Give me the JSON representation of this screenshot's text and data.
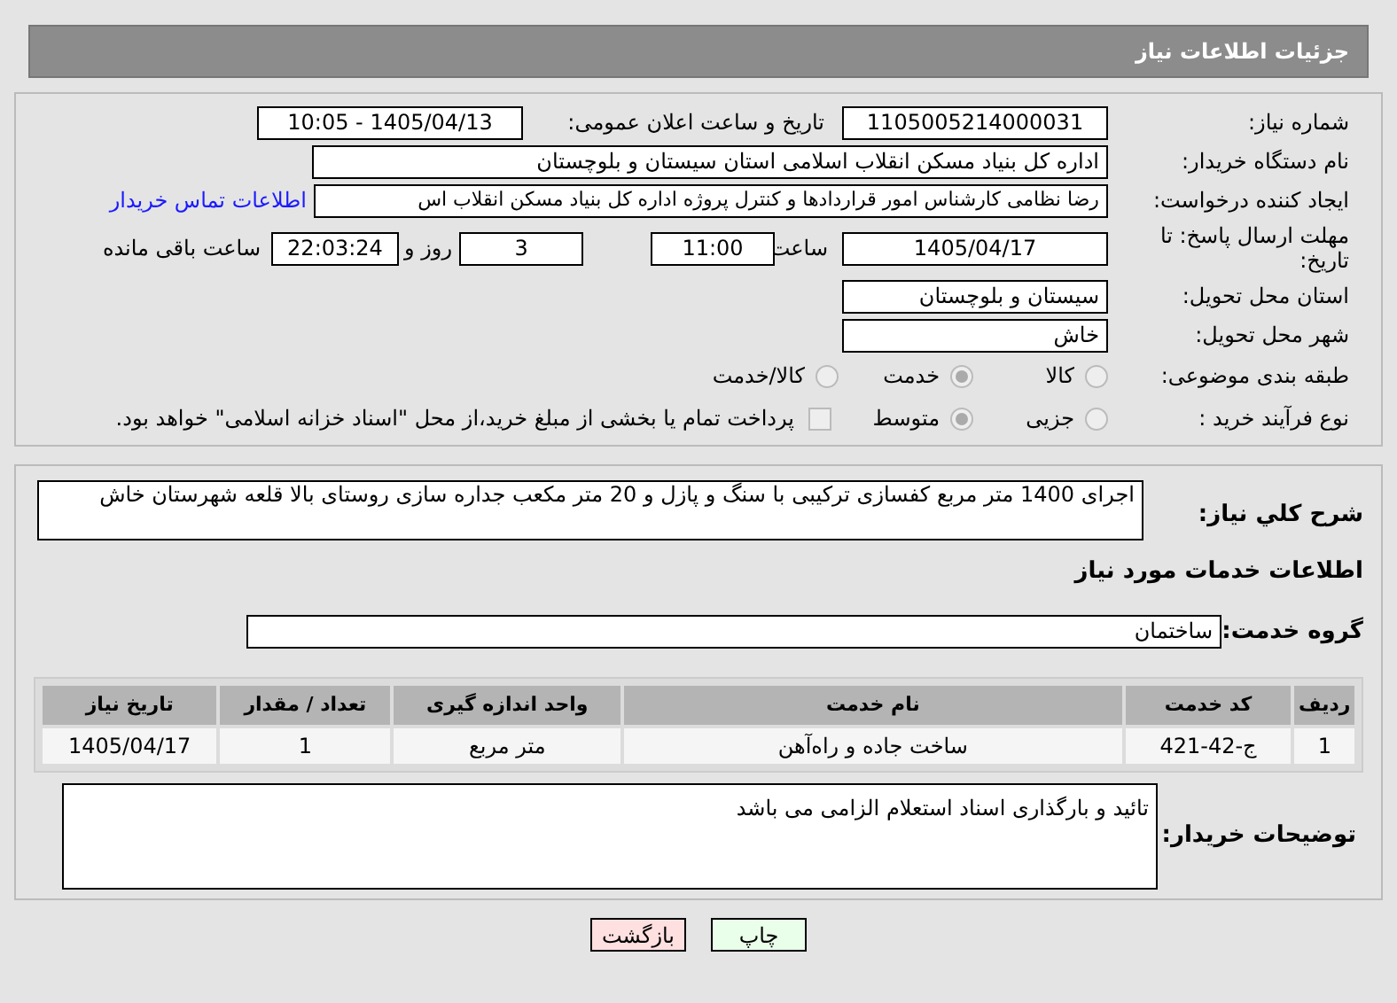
{
  "header": {
    "title": "جزئیات اطلاعات نیاز"
  },
  "need_number": {
    "label": "شماره نیاز:",
    "value": "1105005214000031"
  },
  "announce_datetime": {
    "label": "تاریخ و ساعت اعلان عمومی:",
    "value": "1405/04/13 - 10:05"
  },
  "buyer_org": {
    "label": "نام دستگاه خریدار:",
    "value": "اداره کل بنیاد مسکن انقلاب اسلامی استان سیستان و بلوچستان"
  },
  "requester": {
    "label": "ایجاد کننده درخواست:",
    "value": "رضا نظامی کارشناس امور قراردادها و کنترل پروژه اداره کل بنیاد مسکن انقلاب اس",
    "link": "اطلاعات تماس خریدار"
  },
  "deadline": {
    "label": "مهلت ارسال پاسخ: تا تاریخ:",
    "date": "1405/04/17",
    "time_label": "ساعت",
    "time": "11:00",
    "days": "3",
    "days_label": "روز و",
    "remaining": "22:03:24",
    "remaining_label": "ساعت باقی مانده"
  },
  "province": {
    "label": "استان محل تحویل:",
    "value": "سیستان و بلوچستان"
  },
  "city": {
    "label": "شهر محل تحویل:",
    "value": "خاش"
  },
  "category": {
    "label": "طبقه بندی موضوعی:",
    "options": [
      {
        "label": "کالا",
        "selected": false
      },
      {
        "label": "خدمت",
        "selected": true
      },
      {
        "label": "کالا/خدمت",
        "selected": false
      }
    ]
  },
  "purchase_type": {
    "label": "نوع فرآیند خرید :",
    "options": [
      {
        "label": "جزیی",
        "selected": false
      },
      {
        "label": "متوسط",
        "selected": true
      }
    ],
    "treasury": {
      "label": "پرداخت تمام یا بخشی از مبلغ خرید،از محل \"اسناد خزانه اسلامی\" خواهد بود.",
      "checked": false
    }
  },
  "description": {
    "label": "شرح کلي نياز:",
    "value": "اجرای 1400 متر مربع کفسازی ترکیبی با سنگ و پازل و 20 متر مکعب جداره سازی روستای بالا قلعه شهرستان خاش"
  },
  "services_title": "اطلاعات خدمات مورد نیاز",
  "service_group": {
    "label": "گروه خدمت:",
    "value": "ساختمان"
  },
  "table": {
    "columns": [
      "ردیف",
      "کد خدمت",
      "نام خدمت",
      "واحد اندازه گیری",
      "تعداد / مقدار",
      "تاریخ نیاز"
    ],
    "rows": [
      [
        "1",
        "ج-42-421",
        "ساخت جاده و راه‌آهن",
        "متر مربع",
        "1",
        "1405/04/17"
      ]
    ]
  },
  "buyer_notes": {
    "label": "توضیحات خریدار:",
    "value": "تائید و بارگذاری اسناد استعلام الزامی می باشد"
  },
  "buttons": [
    {
      "label": "چاپ",
      "kind": "print"
    },
    {
      "label": "بازگشت",
      "kind": "back"
    }
  ]
}
